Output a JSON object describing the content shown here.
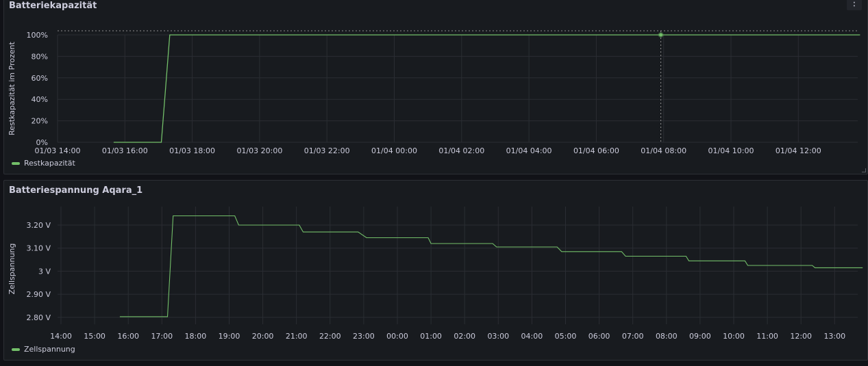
{
  "panel1": {
    "title": "Batteriekapazität",
    "menu_icon": "⋮",
    "legend_label": "Restkapazität",
    "color": "#73bf69"
  },
  "panel2": {
    "title": "Batteriespannung Aqara_1",
    "legend_label": "Zellspannung",
    "color": "#73bf69"
  },
  "chart_data": [
    {
      "type": "line",
      "title": "Batteriekapazität",
      "ylabel": "Restkapazität im Prozent",
      "xlabel": "",
      "x_ticks": [
        "01/03 14:00",
        "01/03 16:00",
        "01/03 18:00",
        "01/03 20:00",
        "01/03 22:00",
        "01/04 00:00",
        "01/04 02:00",
        "01/04 04:00",
        "01/04 06:00",
        "01/04 08:00",
        "01/04 10:00",
        "01/04 12:00"
      ],
      "y_ticks": [
        "0%",
        "20%",
        "40%",
        "60%",
        "80%",
        "100%"
      ],
      "xlim": [
        "01/03 14:00",
        "01/04 14:00"
      ],
      "ylim": [
        0,
        100
      ],
      "grid": true,
      "legend_placement": "bottom-left",
      "series": [
        {
          "name": "Restkapazität",
          "color": "#73bf69",
          "points": [
            [
              "01/03 15:40",
              0
            ],
            [
              "01/03 17:05",
              0
            ],
            [
              "01/03 17:20",
              100
            ],
            [
              "01/04 13:50",
              100
            ]
          ]
        }
      ],
      "hover": {
        "x": "01/04 07:55",
        "y": 100
      }
    },
    {
      "type": "line",
      "title": "Batteriespannung Aqara_1",
      "ylabel": "Zellspannung",
      "xlabel": "",
      "x_ticks": [
        "14:00",
        "15:00",
        "16:00",
        "17:00",
        "18:00",
        "19:00",
        "20:00",
        "21:00",
        "22:00",
        "23:00",
        "00:00",
        "01:00",
        "02:00",
        "03:00",
        "04:00",
        "05:00",
        "06:00",
        "07:00",
        "08:00",
        "09:00",
        "10:00",
        "11:00",
        "12:00",
        "13:00"
      ],
      "y_ticks": [
        "2.80 V",
        "2.90 V",
        "3 V",
        "3.10 V",
        "3.20 V"
      ],
      "ylim": [
        2.77,
        3.28
      ],
      "grid": true,
      "legend_placement": "bottom-left",
      "series": [
        {
          "name": "Zellspannung",
          "color": "#73bf69",
          "points": [
            [
              "15:45",
              2.803
            ],
            [
              "17:10",
              2.803
            ],
            [
              "17:20",
              3.24
            ],
            [
              "19:10",
              3.24
            ],
            [
              "19:17",
              3.2
            ],
            [
              "21:05",
              3.2
            ],
            [
              "21:12",
              3.17
            ],
            [
              "22:50",
              3.17
            ],
            [
              "23:05",
              3.145
            ],
            [
              "00:55",
              3.145
            ],
            [
              "01:00",
              3.12
            ],
            [
              "02:50",
              3.12
            ],
            [
              "02:57",
              3.105
            ],
            [
              "04:45",
              3.105
            ],
            [
              "04:53",
              3.085
            ],
            [
              "06:40",
              3.085
            ],
            [
              "06:47",
              3.065
            ],
            [
              "08:35",
              3.065
            ],
            [
              "08:40",
              3.045
            ],
            [
              "10:20",
              3.045
            ],
            [
              "10:25",
              3.025
            ],
            [
              "12:20",
              3.025
            ],
            [
              "12:25",
              3.015
            ],
            [
              "13:50",
              3.015
            ]
          ]
        }
      ]
    }
  ]
}
